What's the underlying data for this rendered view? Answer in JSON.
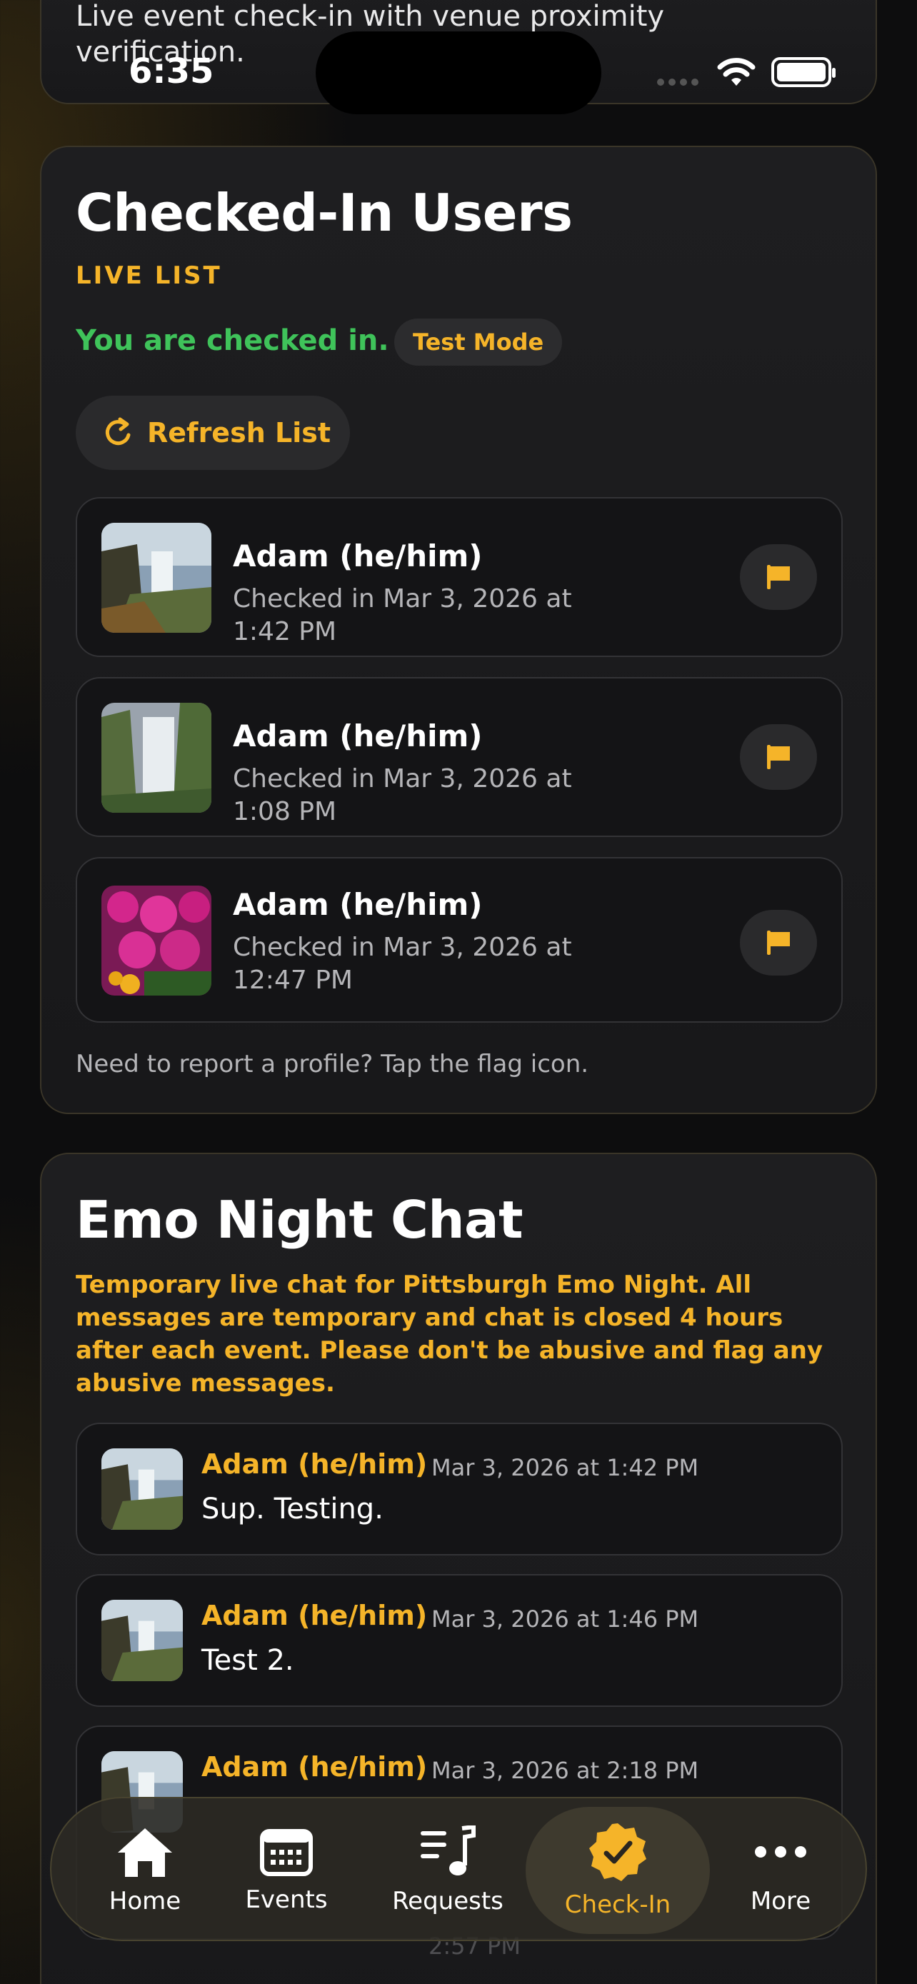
{
  "status_bar": {
    "time": "6:35"
  },
  "top_card": {
    "description": "Live event check-in with venue proximity verification."
  },
  "checked_in": {
    "title": "Checked-In Users",
    "kicker": "LIVE LIST",
    "status": "You are checked in.",
    "mode_badge": "Test Mode",
    "refresh_label": "Refresh List",
    "users": [
      {
        "name": "Adam (he/him)",
        "time": "Checked in Mar 3, 2026 at 1:42 PM",
        "photo": "waterfall-rocks"
      },
      {
        "name": "Adam (he/him)",
        "time": "Checked in Mar 3, 2026 at 1:08 PM",
        "photo": "waterfall-cliff"
      },
      {
        "name": "Adam (he/him)",
        "time": "Checked in Mar 3, 2026 at 12:47 PM",
        "photo": "pink-flowers"
      }
    ],
    "note": "Need to report a profile? Tap the flag icon."
  },
  "chat": {
    "title": "Emo Night Chat",
    "description": "Temporary live chat for Pittsburgh Emo Night. All messages are temporary and chat is closed 4 hours after each event. Please don't be abusive and flag any abusive messages.",
    "messages": [
      {
        "name": "Adam (he/him)",
        "date": "Mar 3, 2026 at 1:42 PM",
        "text": "Sup. Testing."
      },
      {
        "name": "Adam (he/him)",
        "date": "Mar 3, 2026 at 1:46 PM",
        "text": "Test 2."
      },
      {
        "name": "Adam (he/him)",
        "date": "Mar 3, 2026 at 2:18 PM",
        "text": ""
      }
    ],
    "partial_date": "2:57 PM"
  },
  "tabbar": {
    "tabs": [
      {
        "label": "Home",
        "icon": "house-icon"
      },
      {
        "label": "Events",
        "icon": "calendar-icon"
      },
      {
        "label": "Requests",
        "icon": "music-list-icon"
      },
      {
        "label": "Check-In",
        "icon": "checkmark-seal-icon",
        "active": true
      },
      {
        "label": "More",
        "icon": "ellipsis-icon"
      }
    ]
  },
  "colors": {
    "accent": "#f5b429",
    "success": "#3fc35a",
    "background": "#0d0d0e"
  }
}
